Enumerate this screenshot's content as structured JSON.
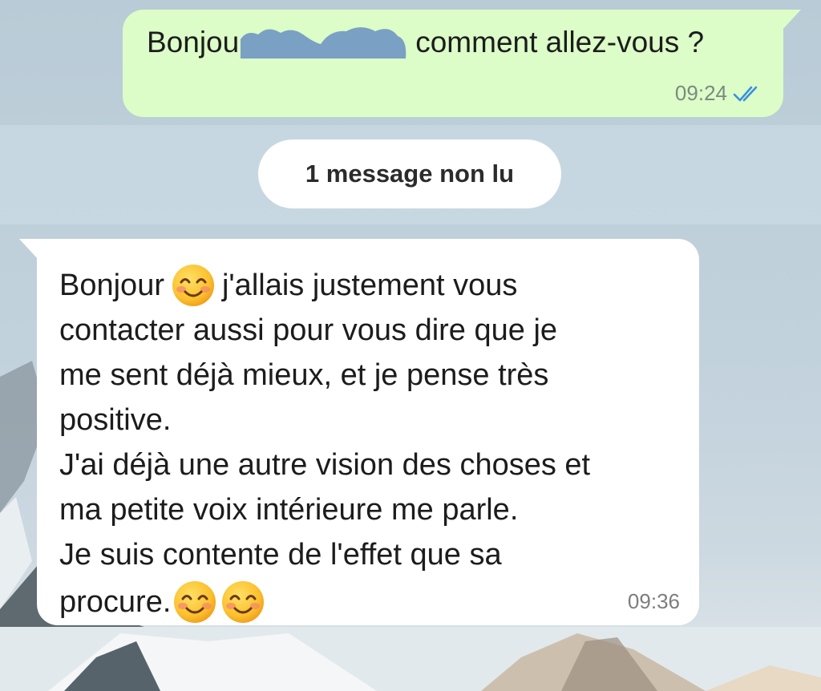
{
  "outgoing": {
    "text_before": "Bonjou",
    "text_after": "comment allez-vous ?",
    "time": "09:24",
    "status_icon": "double-check-read-icon"
  },
  "unread_banner": {
    "label": "1 message non lu"
  },
  "incoming": {
    "line1_a": "Bonjour",
    "line1_b": "j'allais justement vous",
    "line2": "contacter aussi pour vous dire que je",
    "line3": "me sent déjà mieux, et je pense très",
    "line4": "positive.",
    "line5": "J'ai déjà une autre vision des choses et",
    "line6": "ma petite voix intérieure me parle.",
    "line7": "Je suis contente de l'effet que sa",
    "line8": "procure.",
    "time": "09:36",
    "emoji_icon": "smiling-face-with-smiling-eyes-icon"
  },
  "colors": {
    "outgoing_bubble": "#dcfcc8",
    "incoming_bubble": "#ffffff",
    "read_check": "#3b8fe0"
  }
}
